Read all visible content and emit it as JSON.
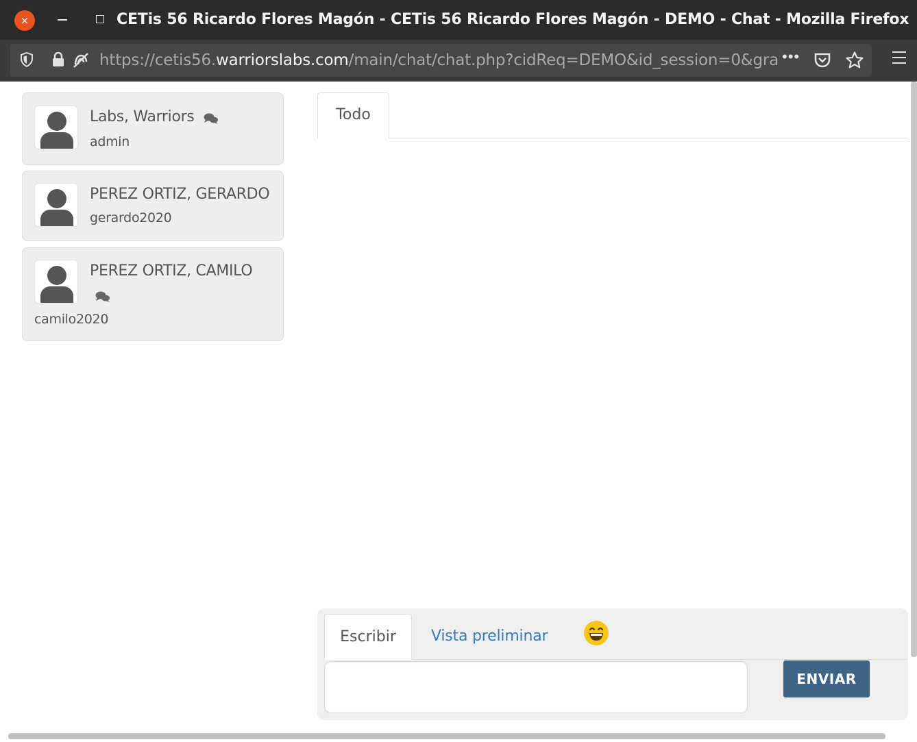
{
  "window": {
    "title": "CETis 56 Ricardo Flores Magón - CETis 56 Ricardo Flores Magón - DEMO - Chat - Mozilla Firefox",
    "close_glyph": "×"
  },
  "urlbar": {
    "url_prefix": "https://cetis56.",
    "url_host": "warriorslabs.com",
    "url_path": "/main/chat/chat.php?cidReq=DEMO&id_session=0&gra",
    "more_glyph": "•••"
  },
  "users": [
    {
      "name": "Labs, Warriors",
      "login": "admin",
      "has_chat_icon": true
    },
    {
      "name": "PEREZ ORTIZ, GERARDO",
      "login": "gerardo2020",
      "has_chat_icon": false
    },
    {
      "name": "PEREZ ORTIZ, CAMILO",
      "login": "camilo2020",
      "has_chat_icon": true
    }
  ],
  "chat": {
    "tab_all": "Todo"
  },
  "composer": {
    "tab_write": "Escribir",
    "tab_preview": "Vista preliminar",
    "send_label": "ENVIAR",
    "input_value": ""
  },
  "colors": {
    "accent_send": "#3d6485",
    "link": "#3a7ab8",
    "close_button": "#e95420"
  }
}
